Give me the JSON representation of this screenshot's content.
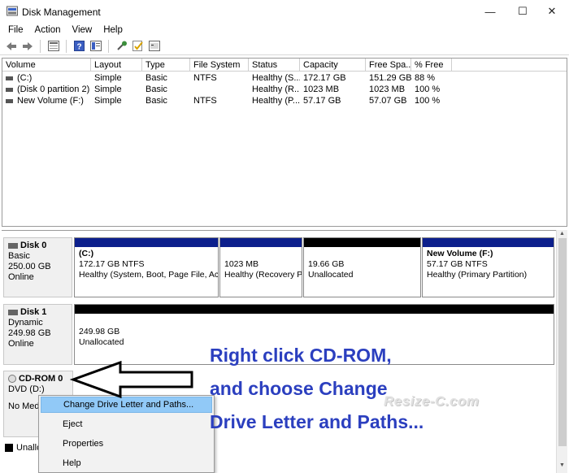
{
  "window": {
    "title": "Disk Management",
    "controls": {
      "minimize": "—",
      "maximize": "☐",
      "close": "✕"
    }
  },
  "menu": [
    "File",
    "Action",
    "View",
    "Help"
  ],
  "toolbar": {
    "buttons": [
      "back-icon",
      "forward-icon",
      "disk-list-icon",
      "help-icon",
      "properties-icon",
      "rescan-icon",
      "check-icon",
      "console-icon"
    ]
  },
  "volume_list": {
    "columns": [
      "Volume",
      "Layout",
      "Type",
      "File System",
      "Status",
      "Capacity",
      "Free Spa...",
      "% Free"
    ],
    "rows": [
      [
        "(C:)",
        "Simple",
        "Basic",
        "NTFS",
        "Healthy (S...",
        "172.17 GB",
        "151.29 GB",
        "88 %"
      ],
      [
        "(Disk 0 partition 2)",
        "Simple",
        "Basic",
        "",
        "Healthy (R...",
        "1023 MB",
        "1023 MB",
        "100 %"
      ],
      [
        "New Volume (F:)",
        "Simple",
        "Basic",
        "NTFS",
        "Healthy (P...",
        "57.17 GB",
        "57.07 GB",
        "100 %"
      ]
    ]
  },
  "disks": [
    {
      "name": "Disk 0",
      "type": "Basic",
      "size": "250.00 GB",
      "status": "Online",
      "partitions": [
        {
          "name": "(C:)",
          "size": "172.17 GB NTFS",
          "status": "Healthy (System, Boot, Page File, Acti",
          "bar": "blue"
        },
        {
          "name": "",
          "size": "1023 MB",
          "status": "Healthy (Recovery P",
          "bar": "blue"
        },
        {
          "name": "",
          "size": "19.66 GB",
          "status": "Unallocated",
          "bar": "black"
        },
        {
          "name": "New Volume  (F:)",
          "size": "57.17 GB NTFS",
          "status": "Healthy (Primary Partition)",
          "bar": "blue"
        }
      ]
    },
    {
      "name": "Disk 1",
      "type": "Dynamic",
      "size": "249.98 GB",
      "status": "Online",
      "partitions": [
        {
          "name": "",
          "size": "249.98 GB",
          "status": "Unallocated",
          "bar": "black"
        }
      ]
    },
    {
      "name": "CD-ROM 0",
      "type": "DVD (D:)",
      "size": "",
      "status": "No Med"
    }
  ],
  "legend": {
    "unallocated_label": "Unallo"
  },
  "context_menu": {
    "items": [
      "Change Drive Letter and Paths...",
      "Eject",
      "Properties",
      "Help"
    ],
    "highlighted_index": 0
  },
  "annotation": {
    "lines": [
      "Right click CD-ROM,",
      "and choose Change",
      "Drive Letter and Paths..."
    ],
    "color": "#2b3fbf"
  },
  "watermark": "Resize-C.com",
  "colors": {
    "partition_bar": "#0c1f8c",
    "unallocated_bar": "#000000",
    "highlight": "#91c9f7"
  }
}
